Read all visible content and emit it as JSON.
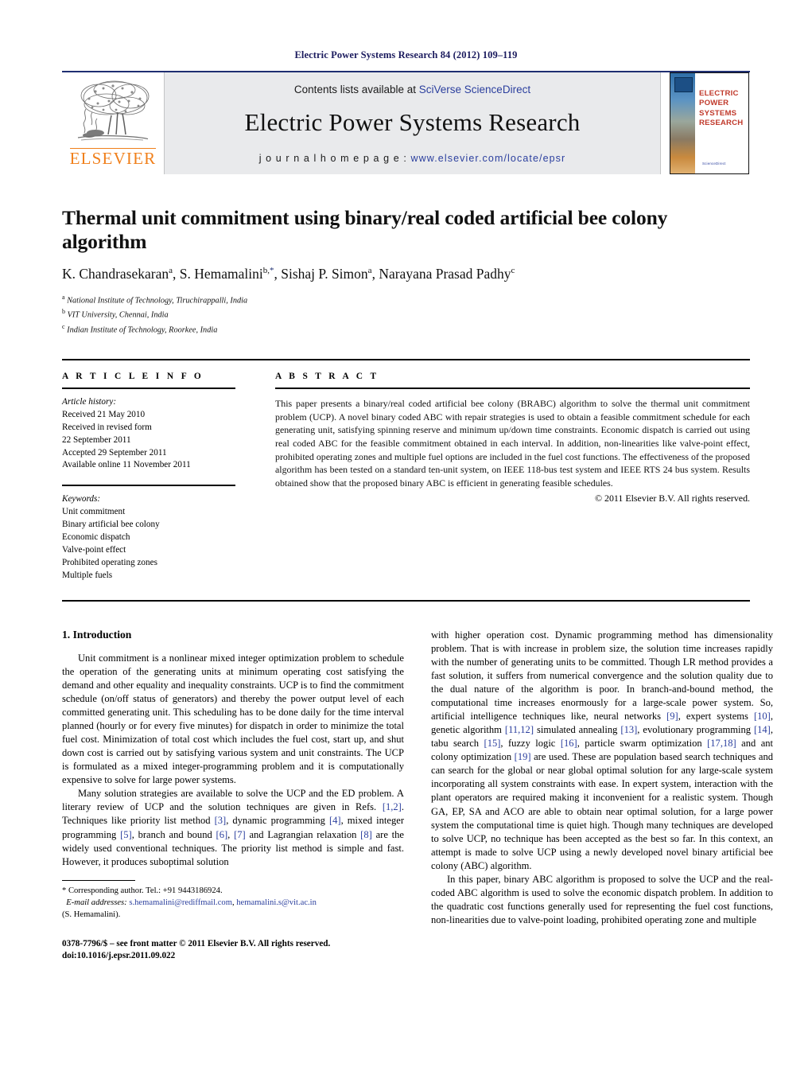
{
  "running_head": "Electric Power Systems Research 84 (2012) 109–119",
  "header": {
    "publisher_name": "ELSEVIER",
    "banner": {
      "contents_prefix": "Contents lists available at ",
      "sciencedirect_link": "SciVerse ScienceDirect",
      "journal_name": "Electric Power Systems Research",
      "homepage_label": "j o u r n a l   h o m e p a g e :   ",
      "homepage_url": "www.elsevier.com/locate/epsr"
    },
    "cover": {
      "title_line1": "ELECTRIC POWER",
      "title_line2": "SYSTEMS RESEARCH",
      "footer_text": "ScienceDirect"
    }
  },
  "article": {
    "title": "Thermal unit commitment using binary/real coded artificial bee colony algorithm",
    "authors": [
      {
        "name": "K. Chandrasekaran",
        "sup": "a",
        "star": false
      },
      {
        "name": "S. Hemamalini",
        "sup": "b,",
        "star": true
      },
      {
        "name": "Sishaj P. Simon",
        "sup": "a",
        "star": false
      },
      {
        "name": "Narayana Prasad Padhy",
        "sup": "c",
        "star": false
      }
    ],
    "affiliations": [
      {
        "marker": "a",
        "text": "National Institute of Technology, Tiruchirappalli, India"
      },
      {
        "marker": "b",
        "text": "VIT University, Chennai, India"
      },
      {
        "marker": "c",
        "text": "Indian Institute of Technology, Roorkee, India"
      }
    ]
  },
  "info": {
    "heading": "A R T I C L E   I N F O",
    "history_label": "Article history:",
    "history_lines": [
      "Received 21 May 2010",
      "Received in revised form",
      "22 September 2011",
      "Accepted 29 September 2011",
      "Available online 11 November 2011"
    ],
    "keywords_label": "Keywords:",
    "keywords": [
      "Unit commitment",
      "Binary artificial bee colony",
      "Economic dispatch",
      "Valve-point effect",
      "Prohibited operating zones",
      "Multiple fuels"
    ]
  },
  "abstract": {
    "heading": "A B S T R A C T",
    "text": "This paper presents a binary/real coded artificial bee colony (BRABC) algorithm to solve the thermal unit commitment problem (UCP). A novel binary coded ABC with repair strategies is used to obtain a feasible commitment schedule for each generating unit, satisfying spinning reserve and minimum up/down time constraints. Economic dispatch is carried out using real coded ABC for the feasible commitment obtained in each interval. In addition, non-linearities like valve-point effect, prohibited operating zones and multiple fuel options are included in the fuel cost functions. The effectiveness of the proposed algorithm has been tested on a standard ten-unit system, on IEEE 118-bus test system and IEEE RTS 24 bus system. Results obtained show that the proposed binary ABC is efficient in generating feasible schedules.",
    "copyright": "© 2011 Elsevier B.V. All rights reserved."
  },
  "body": {
    "section_number_title": "1.  Introduction",
    "left_paragraphs": [
      "Unit commitment is a nonlinear mixed integer optimization problem to schedule the operation of the generating units at minimum operating cost satisfying the demand and other equality and inequality constraints. UCP is to find the commitment schedule (on/off status of generators) and thereby the power output level of each committed generating unit. This scheduling has to be done daily for the time interval planned (hourly or for every five minutes) for dispatch in order to minimize the total fuel cost. Minimization of total cost which includes the fuel cost, start up, and shut down cost is carried out by satisfying various system and unit constraints. The UCP is formulated as a mixed integer-programming problem and it is computationally expensive to solve for large power systems."
    ],
    "left_paragraph2_parts": [
      "Many solution strategies are available to solve the UCP and the ED problem. A literary review of UCP and the solution techniques are given in Refs. ",
      "[1,2]",
      ". Techniques like priority list method ",
      "[3]",
      ", dynamic programming ",
      "[4]",
      ", mixed integer programming ",
      "[5]",
      ", branch and bound ",
      "[6]",
      ", ",
      "[7]",
      " and Lagrangian relaxation ",
      "[8]",
      " are the widely used conventional techniques. The priority list method is simple and fast. However, it produces suboptimal solution"
    ],
    "right_paragraph1_parts": [
      "with higher operation cost. Dynamic programming method has dimensionality problem. That is with increase in problem size, the solution time increases rapidly with the number of generating units to be committed. Though LR method provides a fast solution, it suffers from numerical convergence and the solution quality due to the dual nature of the algorithm is poor. In branch-and-bound method, the computational time increases enormously for a large-scale power system. So, artificial intelligence techniques like, neural networks ",
      "[9]",
      ", expert systems ",
      "[10]",
      ", genetic algorithm ",
      "[11,12]",
      " simulated annealing ",
      "[13]",
      ", evolutionary programming ",
      "[14]",
      ", tabu search ",
      "[15]",
      ", fuzzy logic ",
      "[16]",
      ", particle swarm optimization ",
      "[17,18]",
      " and ant colony optimization ",
      "[19]",
      " are used. These are population based search techniques and can search for the global or near global optimal solution for any large-scale system incorporating all system constraints with ease. In expert system, interaction with the plant operators are required making it inconvenient for a realistic system. Though GA, EP, SA and ACO are able to obtain near optimal solution, for a large power system the computational time is quiet high. Though many techniques are developed to solve UCP, no technique has been accepted as the best so far. In this context, an attempt is made to solve UCP using a newly developed novel binary artificial bee colony (ABC) algorithm."
    ],
    "right_paragraph2": "In this paper, binary ABC algorithm is proposed to solve the UCP and the real-coded ABC algorithm is used to solve the economic dispatch problem. In addition to the quadratic cost functions generally used for representing the fuel cost functions, non-linearities due to valve-point loading, prohibited operating zone and multiple"
  },
  "footnote": {
    "corresponding": "* Corresponding author. Tel.: +91 9443186924.",
    "email_label": "E-mail addresses:",
    "email1": "s.hemamalini@rediffmail.com",
    "email_sep": ", ",
    "email2": "hemamalini.s@vit.ac.in",
    "email_owner": "(S. Hemamalini).",
    "front_matter": "0378-7796/$ – see front matter © 2011 Elsevier B.V. All rights reserved.",
    "doi": "doi:10.1016/j.epsr.2011.09.022"
  }
}
